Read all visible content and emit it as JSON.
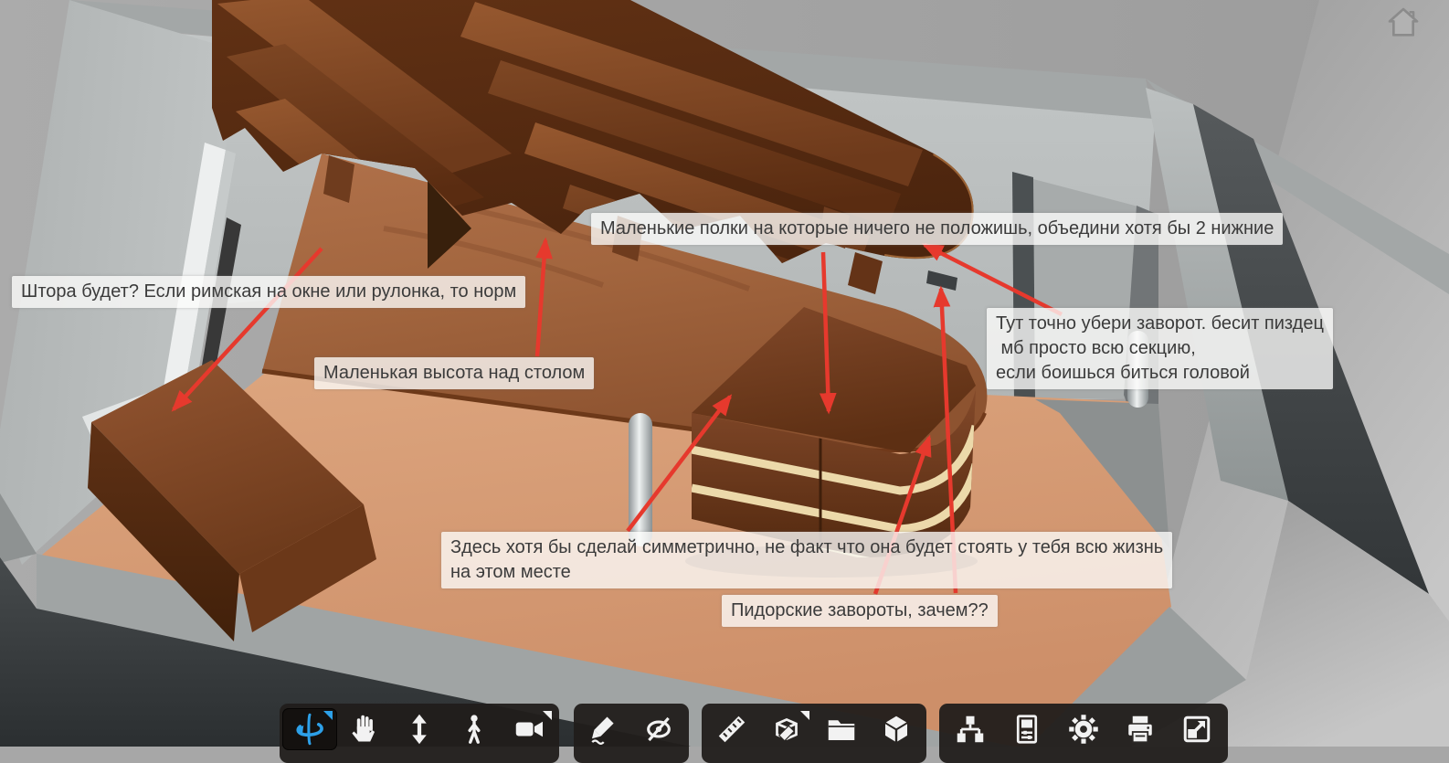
{
  "scene": {
    "type": "3d-room-plan-view",
    "floor_color": "#d0936e",
    "wall_color": "#b9bdbd",
    "outer_wall_dark": "#35393b",
    "wood_shelf": "#7b4524",
    "wood_desk": "#a2653e",
    "drawer_accent_color": "#ecd9aa",
    "arrow_color": "#e6392d",
    "note_background": "rgba(253,252,251,0.78)",
    "note_text_color": "#3b3b3b"
  },
  "annotations": [
    {
      "text": "Маленькие полки на которые ничего не положишь, объедини хотя бы 2 нижние"
    },
    {
      "text": "Штора будет? Если римская на окне или рулонка, то норм"
    },
    {
      "text": "Маленькая высота над столом"
    },
    {
      "text": "Тут точно убери заворот. бесит пиздец\n мб просто всю секцию,\nесли боишься биться головой"
    },
    {
      "text": "Здесь хотя бы сделай симметрично, не факт что она будет стоять у тебя всю жизнь\nна этом месте"
    },
    {
      "text": "Пидорские завороты, зачем??"
    }
  ],
  "toolbar": {
    "groups": [
      {
        "name": "view",
        "buttons": [
          {
            "icon": "orbit-icon",
            "active": true,
            "has_flyout": true
          },
          {
            "icon": "pan-hand-icon",
            "active": false,
            "has_flyout": false
          },
          {
            "icon": "elevation-icon",
            "active": false,
            "has_flyout": false
          },
          {
            "icon": "walk-icon",
            "active": false,
            "has_flyout": false
          },
          {
            "icon": "camera-icon",
            "active": false,
            "has_flyout": true
          }
        ]
      },
      {
        "name": "edit",
        "buttons": [
          {
            "icon": "pencil-icon",
            "active": false,
            "has_flyout": false
          },
          {
            "icon": "hide-eye-icon",
            "active": false,
            "has_flyout": false
          }
        ]
      },
      {
        "name": "tools",
        "buttons": [
          {
            "icon": "ruler-icon",
            "active": false,
            "has_flyout": false
          },
          {
            "icon": "edit-object-icon",
            "active": false,
            "has_flyout": true
          },
          {
            "icon": "folder-icon",
            "active": false,
            "has_flyout": false
          },
          {
            "icon": "cube-icon",
            "active": false,
            "has_flyout": false
          }
        ]
      },
      {
        "name": "settings",
        "buttons": [
          {
            "icon": "structure-icon",
            "active": false,
            "has_flyout": false
          },
          {
            "icon": "properties-icon",
            "active": false,
            "has_flyout": false
          },
          {
            "icon": "settings-gear-icon",
            "active": false,
            "has_flyout": false
          },
          {
            "icon": "print-icon",
            "active": false,
            "has_flyout": false
          },
          {
            "icon": "fullscreen-icon",
            "active": false,
            "has_flyout": false
          }
        ]
      }
    ]
  },
  "header": {
    "home_button_icon": "home-icon"
  }
}
